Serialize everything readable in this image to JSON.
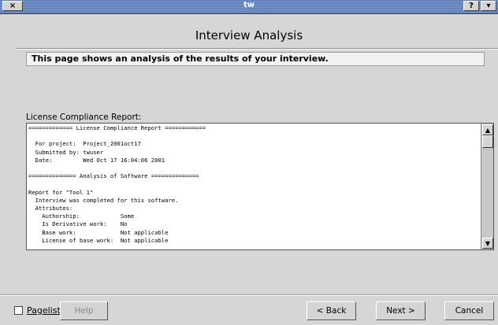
{
  "window": {
    "title": "tw",
    "close_glyph": "×",
    "help_glyph": "?",
    "menu_glyph": "▾"
  },
  "page": {
    "title": "Interview Analysis",
    "description": "This page shows an analysis of the results of your interview."
  },
  "report": {
    "label": "License Compliance Report:",
    "lines": [
      "============= License Compliance Report ============",
      "",
      "  For project:  Project_2001oct17",
      "  Submitted by: twuser",
      "  Date:         Wed Oct 17 16:04:06 2001",
      "",
      "============== Analysis of Software ==============",
      "",
      "Report for \"Tool 1\"",
      "  Interview was completed for this software.",
      "  Attributes:",
      "    Authorship:            Some",
      "    Is Derivative work:    No",
      "    Base work:             Not applicable",
      "    License of base work:  Not applicable"
    ],
    "scroll_up_glyph": "▲",
    "scroll_down_glyph": "▼"
  },
  "footer": {
    "pagelist_label": "Pagelist",
    "help_label": "Help",
    "back_label": "< Back",
    "next_label": "Next >",
    "cancel_label": "Cancel"
  }
}
